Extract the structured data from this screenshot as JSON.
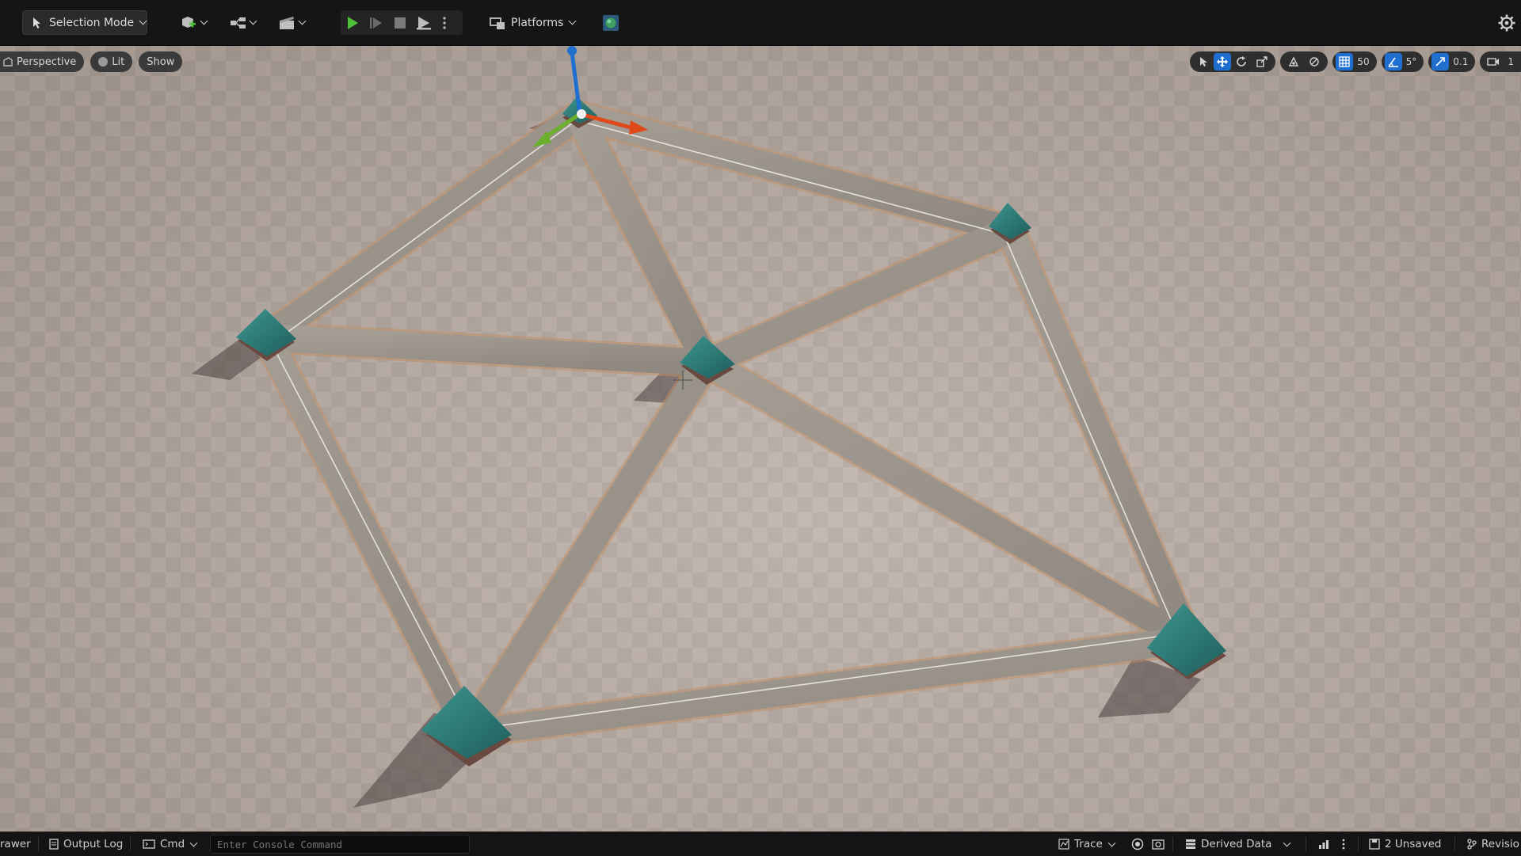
{
  "toolbar": {
    "selection_mode_label": "Selection Mode",
    "platforms_label": "Platforms",
    "icons": [
      "selection-mode-icon",
      "add-actor-icon",
      "blueprint-icon",
      "cinematics-icon",
      "play-icon",
      "advance-frame-icon",
      "stop-icon",
      "launch-icon",
      "more-options-icon",
      "platforms-icon",
      "source-control-icon",
      "settings-icon"
    ]
  },
  "viewport": {
    "perspective_label": "Perspective",
    "lit_label": "Lit",
    "show_label": "Show",
    "grid_snap_value": "50",
    "rotation_snap_value": "5°",
    "scale_snap_value": "0.1",
    "camera_speed_value": "1"
  },
  "statusbar": {
    "drawer_label": "rawer",
    "output_log_label": "Output Log",
    "cmd_label": "Cmd",
    "console_placeholder": "Enter Console Command",
    "trace_label": "Trace",
    "derived_data_label": "Derived Data",
    "unsaved_label": "2 Unsaved",
    "revision_label": "Revisio"
  },
  "colors": {
    "accent_blue": "#1f6fd0",
    "play_green": "#4fbf3a",
    "pavilion_teal": "#2f7f7c",
    "selection_outline": "#e0a060"
  }
}
